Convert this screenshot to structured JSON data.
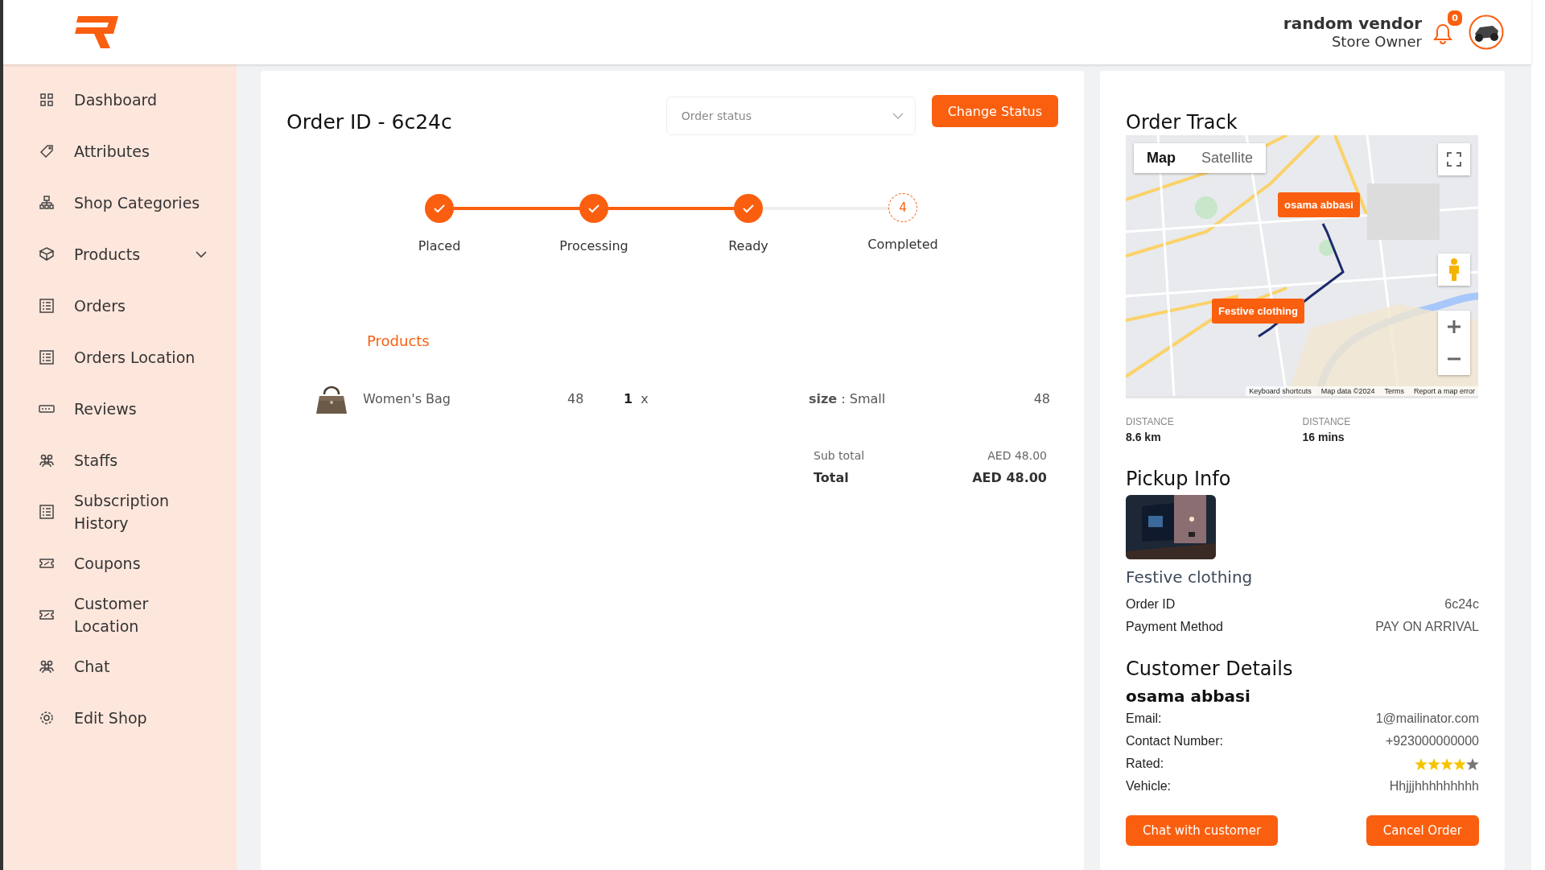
{
  "header": {
    "user_name": "random vendor",
    "user_role": "Store Owner",
    "notification_count": "0"
  },
  "sidebar": {
    "items": [
      {
        "label": "Dashboard",
        "expandable": false
      },
      {
        "label": "Attributes",
        "expandable": false
      },
      {
        "label": "Shop Categories",
        "expandable": false
      },
      {
        "label": "Products",
        "expandable": true
      },
      {
        "label": "Orders",
        "expandable": false
      },
      {
        "label": "Orders Location",
        "expandable": false
      },
      {
        "label": "Reviews",
        "expandable": false
      },
      {
        "label": "Staffs",
        "expandable": false
      },
      {
        "label": "Subscription History",
        "expandable": false
      },
      {
        "label": "Coupons",
        "expandable": false
      },
      {
        "label": "Customer Location",
        "expandable": false
      },
      {
        "label": "Chat",
        "expandable": false
      },
      {
        "label": "Edit Shop",
        "expandable": false
      }
    ]
  },
  "order": {
    "title": "Order ID - 6c24c",
    "status_select": {
      "placeholder": "Order status"
    },
    "change_button": "Change Status",
    "steps": [
      {
        "label": "Placed",
        "done": true
      },
      {
        "label": "Processing",
        "done": true
      },
      {
        "label": "Ready",
        "done": true
      },
      {
        "label": "Completed",
        "done": false,
        "number": "4"
      }
    ],
    "products_heading": "Products",
    "products": [
      {
        "name": "Women's Bag",
        "price": "48",
        "quantity": "1",
        "times": "x",
        "option_label": "size",
        "separator": ":",
        "option_value": "Small",
        "total": "48"
      }
    ],
    "totals": [
      {
        "label": "Sub total",
        "value": "AED 48.00",
        "bold": false
      },
      {
        "label": "Total",
        "value": "AED 48.00",
        "bold": true
      }
    ]
  },
  "order_track": {
    "title": "Order Track",
    "map": {
      "types": [
        {
          "label": "Map",
          "selected": true
        },
        {
          "label": "Satellite",
          "selected": false
        }
      ],
      "markers": [
        "osama abbasi",
        "Festive clothing"
      ],
      "attribution": [
        "Keyboard shortcuts",
        "Map data ©2024",
        "Terms",
        "Report a map error"
      ]
    },
    "stats": [
      {
        "label": "DISTANCE",
        "value": "8.6 km"
      },
      {
        "label": "DISTANCE",
        "value": "16 mins"
      }
    ]
  },
  "pickup": {
    "title": "Pickup Info",
    "shop_name": "Festive clothing",
    "fields": [
      {
        "label": "Order ID",
        "value": "6c24c"
      },
      {
        "label": "Payment Method",
        "value": "PAY ON ARRIVAL"
      }
    ]
  },
  "customer": {
    "title": "Customer Details",
    "name": "osama abbasi",
    "fields": [
      {
        "label": "Email:",
        "value": "1@mailinator.com",
        "kind": "text"
      },
      {
        "label": "Contact Number:",
        "value": "+923000000000",
        "kind": "text"
      },
      {
        "label": "Rated:",
        "stars": 4,
        "kind": "stars"
      },
      {
        "label": "Vehicle:",
        "value": "Hhjjjhhhhhhhhh",
        "kind": "text"
      }
    ],
    "buttons": [
      "Chat with customer",
      "Cancel Order"
    ]
  }
}
